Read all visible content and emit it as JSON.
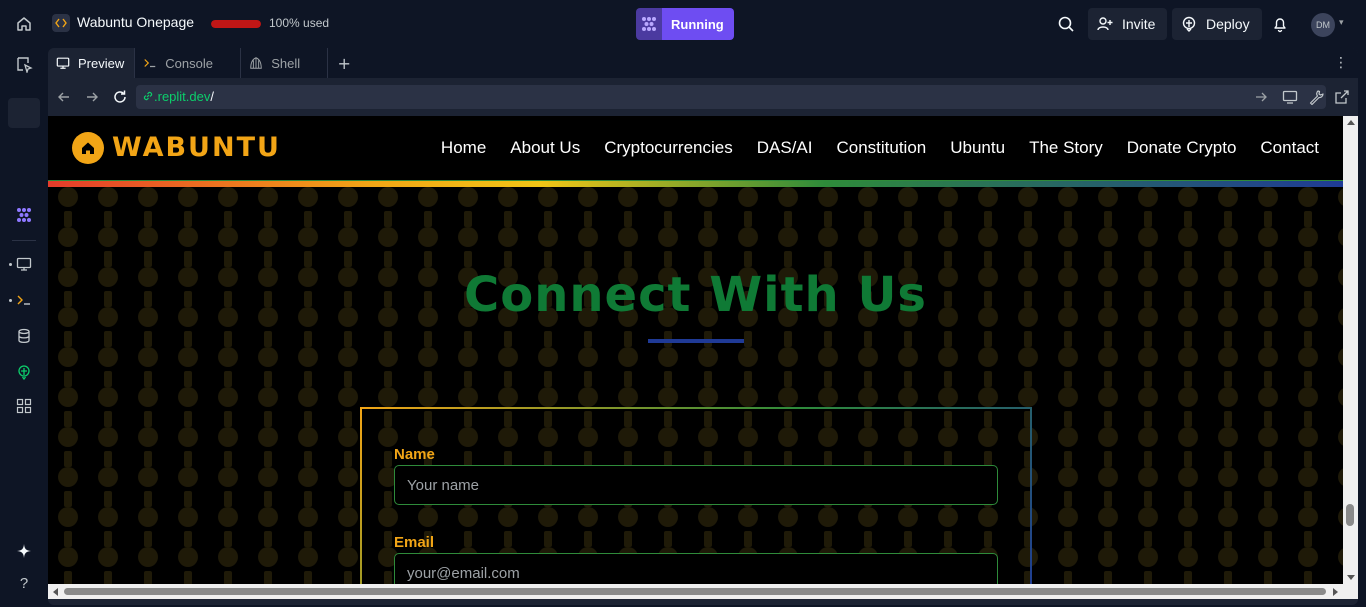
{
  "topbar": {
    "repl_title": "Wabuntu Onepage",
    "usage_text": "100% used",
    "usage_fraction": 1.0,
    "run_status": "Running",
    "invite_label": "Invite",
    "deploy_label": "Deploy",
    "avatar_initials": "DM"
  },
  "tabs": [
    {
      "label": "Preview",
      "icon": "monitor-icon",
      "active": true
    },
    {
      "label": "Console",
      "icon": "terminal-icon",
      "active": false
    },
    {
      "label": "Shell",
      "icon": "shell-icon",
      "active": false
    }
  ],
  "urlbar": {
    "domain": ".replit.dev",
    "path": "/"
  },
  "site": {
    "logo_text": "WABUNTU",
    "nav": [
      "Home",
      "About Us",
      "Cryptocurrencies",
      "DAS/AI",
      "Constitution",
      "Ubuntu",
      "The Story",
      "Donate Crypto",
      "Contact"
    ],
    "section_title": "Connect With Us",
    "form": {
      "name_label": "Name",
      "name_placeholder": "Your name",
      "email_label": "Email",
      "email_placeholder": "your@email.com"
    }
  },
  "colors": {
    "accent_running": "#6e4df2",
    "brand_orange": "#f2a516",
    "title_green": "#0f7a35",
    "url_green": "#0cce6b",
    "usage_red": "#c01616"
  }
}
